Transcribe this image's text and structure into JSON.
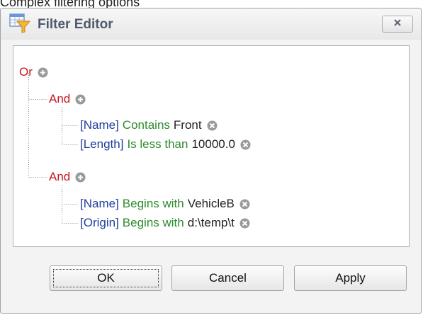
{
  "page": {
    "caption": "Complex filtering options"
  },
  "dialog": {
    "title": "Filter Editor",
    "close_symbol": "×",
    "icon": "filter-editor-icon"
  },
  "tree": {
    "root": {
      "label": "Or",
      "groups": [
        {
          "label": "And",
          "conditions": [
            {
              "field": "[Name]",
              "operator": "Contains",
              "value": "Front"
            },
            {
              "field": "[Length]",
              "operator": "Is less than",
              "value": "10000.0"
            }
          ]
        },
        {
          "label": "And",
          "conditions": [
            {
              "field": "[Name]",
              "operator": "Begins with",
              "value": "VehicleB"
            },
            {
              "field": "[Origin]",
              "operator": "Begins with",
              "value": "d:\\temp\\t"
            }
          ]
        }
      ]
    },
    "add_icon": "plus-circle-icon",
    "remove_icon": "x-circle-icon"
  },
  "buttons": {
    "ok": "OK",
    "cancel": "Cancel",
    "apply": "Apply"
  },
  "colors": {
    "group": "#c8161d",
    "field": "#1f3f9c",
    "operator": "#2e8b2e",
    "value": "#222222"
  }
}
